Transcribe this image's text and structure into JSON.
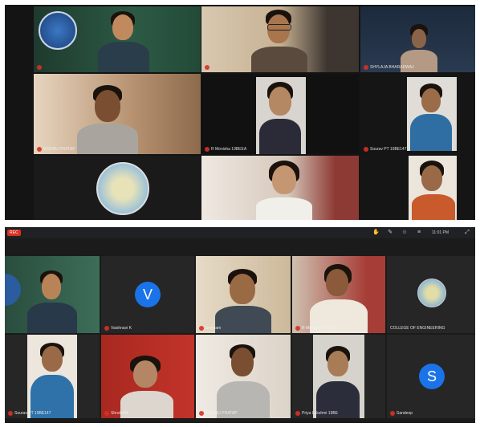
{
  "top_meeting": {
    "participants": [
      {
        "name": "",
        "kind": "video"
      },
      {
        "name": "",
        "kind": "video"
      },
      {
        "name": "SHYLAJA BHARADWAJ",
        "kind": "video"
      },
      {
        "name": "VISHNU PRATAP",
        "kind": "video"
      },
      {
        "name": "R Monisha 19BEEA",
        "kind": "video"
      },
      {
        "name": "Sourav PT 19BE147",
        "kind": "video"
      },
      {
        "name": "",
        "kind": "logo"
      },
      {
        "name": "",
        "kind": "video"
      },
      {
        "name": "",
        "kind": "video"
      }
    ]
  },
  "bottom_meeting": {
    "rec_label": "REC",
    "toolbar_text": "11:01 PM",
    "participants": [
      {
        "name": "",
        "kind": "video"
      },
      {
        "name": "Vaishnavi K",
        "kind": "avatar",
        "initial": "V",
        "color": "#1a73e8"
      },
      {
        "name": "Sreeram",
        "kind": "video"
      },
      {
        "name": "R Monisha 19BEEA",
        "kind": "video"
      },
      {
        "name": "COLLEGE OF ENGINEERING",
        "kind": "logo"
      },
      {
        "name": "Sourav PT 19BE147",
        "kind": "video"
      },
      {
        "name": "Shruthi M",
        "kind": "video"
      },
      {
        "name": "VISHNU PRATAP",
        "kind": "video"
      },
      {
        "name": "Priya Lakshmi 19BE",
        "kind": "video"
      },
      {
        "name": "Sandeep",
        "kind": "avatar",
        "initial": "S",
        "color": "#1a73e8"
      }
    ]
  },
  "colors": {
    "background": "#141414",
    "mic_off": "#d93025",
    "avatar": "#1a73e8"
  }
}
